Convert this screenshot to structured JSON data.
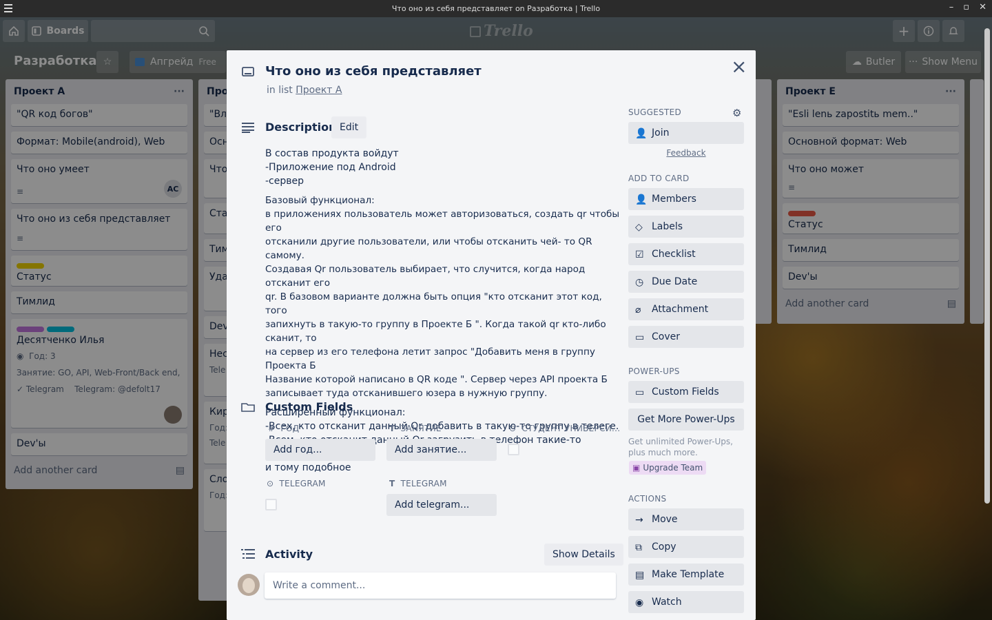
{
  "window": {
    "title": "Что оно из себя представляет on Разработка | Trello",
    "controls": [
      "–",
      "▫",
      "✕"
    ]
  },
  "header": {
    "boards_label": "Boards",
    "logo": "Trello"
  },
  "board": {
    "name": "Разработка",
    "team": "Апгрейд",
    "team_badge": "Free",
    "butler": "Butler",
    "show_menu": "Show Menu"
  },
  "lists": [
    {
      "title": "Проект А",
      "menu": "···",
      "cards": [
        {
          "text": "\"QR код богов\""
        },
        {
          "text": "Формат: Mobile(android), Web"
        },
        {
          "text": "Что оно умеет",
          "avatar": "AC"
        },
        {
          "text": "Что оно из себя представляет"
        },
        {
          "text": "Статус"
        },
        {
          "text": "Тимлид"
        },
        {
          "text": "Десятченко Илья",
          "year": "Год: 3",
          "job": "Занятие: GO, API, Web-Front/Back end, об...",
          "tg_check": "Telegram",
          "tg": "Telegram: @defolt17"
        },
        {
          "text": "Dev'ы"
        }
      ],
      "add": "Add another card"
    },
    {
      "title": "Про",
      "cards": [
        "\"Вла",
        "Осн",
        "Что",
        "Стат",
        "Тим",
        "Удал",
        "Dev",
        "Нест",
        "Кир",
        "Сло"
      ],
      "sub": [
        "Tele",
        "Год:",
        "Tele",
        "Год:"
      ]
    },
    {
      "title": "Проект Е",
      "menu": "···",
      "cards": [
        {
          "text": "\"Esli lenь zapostitь mem..\""
        },
        {
          "text": "Основной формат: Web"
        },
        {
          "text": "Что оно может"
        },
        {
          "text": "Статус"
        },
        {
          "text": "Тимлид"
        },
        {
          "text": "Dev'ы"
        }
      ],
      "add": "Add another card"
    }
  ],
  "modal": {
    "title": "Что оно из себя представляет",
    "in_list_prefix": "in list",
    "in_list": "Проект А",
    "close": "×",
    "description": {
      "heading": "Description",
      "edit": "Edit",
      "paragraphs": [
        "В состав продукта войдут\n-Приложение под Android\n-сервер",
        "Базовый функционал:\nв приложениях пользователь может авторизоваться, создать qr чтобы его\nотсканили другие пользователи, или чтобы отсканить чей- то QR самому.\nСоздавая Qr пользователь выбирает, что случится, когда народ отсканит его\nqr. В базовом варианте должна быть опция \"кто отсканит этот код, того\nзапихнуть в такую-то группу в Проекте Б \". Когда такой qr кто-либо сканит, то\nна сервер из его телефона летит запрос \"Добавить меня в группу Проекта Б\nНазвание которой написано в QR коде \". Сервер через API проекта Б\nзаписывает туда отсканившего юзера в нужную группу.",
        "Расширенный функционал:\n-Всех, кто отсканит данный Qr добавить в такую-то группу в телеге.\n-Всем, кто отсканит данный Qr загрузить в телефон такие-то файлы.\nи тому подобное"
      ]
    },
    "custom_fields": {
      "heading": "Custom Fields",
      "fields": [
        {
          "label": "ГОД",
          "placeholder": "Add год..."
        },
        {
          "label": "ЗАНЯТИЕ",
          "placeholder": "Add занятие..."
        },
        {
          "label": "СТУДЕНТ УНИВЕРСИ..."
        },
        {
          "label": "TELEGRAM"
        },
        {
          "label": "TELEGRAM",
          "placeholder": "Add telegram..."
        }
      ]
    },
    "activity": {
      "heading": "Activity",
      "show_details": "Show Details",
      "comment_placeholder": "Write a comment..."
    },
    "sidebar": {
      "suggested": "SUGGESTED",
      "join": "Join",
      "feedback": "Feedback",
      "add_to_card": "ADD TO CARD",
      "add_items": [
        "Members",
        "Labels",
        "Checklist",
        "Due Date",
        "Attachment",
        "Cover"
      ],
      "power_ups": "POWER-UPS",
      "custom_fields": "Custom Fields",
      "get_more": "Get More Power-Ups",
      "upsell": "Get unlimited Power-Ups, plus much more.",
      "upgrade": "Upgrade Team",
      "actions": "ACTIONS",
      "action_items": [
        "Move",
        "Copy",
        "Make Template",
        "Watch"
      ]
    }
  },
  "colors": {
    "yellow": "#f2d600",
    "purple": "#c377e0",
    "teal": "#00c2e0",
    "red": "#eb5a46",
    "green": "#61bd4f",
    "accent": "#0079bf"
  }
}
